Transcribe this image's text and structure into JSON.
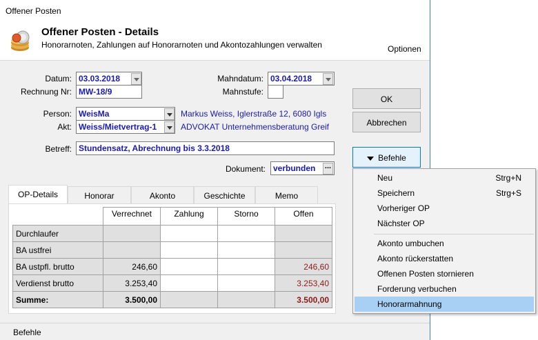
{
  "window": {
    "title": "Offener Posten"
  },
  "header": {
    "title": "Offener Posten - Details",
    "subtitle": "Honorarnoten, Zahlungen auf Honorarnoten und Akontozahlungen verwalten",
    "options_label": "Optionen",
    "icon": "coin-stack-icon"
  },
  "form": {
    "datum_label": "Datum:",
    "datum_value": "03.03.2018",
    "rechnung_label": "Rechnung Nr:",
    "rechnung_value": "MW-18/9",
    "mahndatum_label": "Mahndatum:",
    "mahndatum_value": "03.04.2018",
    "mahnstufe_label": "Mahnstufe:",
    "mahnstufe_value": "",
    "person_label": "Person:",
    "person_value": "WeisMa",
    "person_info": "Markus Weiss, Iglerstraße 12, 6080 Igls",
    "akt_label": "Akt:",
    "akt_value": "Weiss/Mietvertrag-1",
    "akt_info": "ADVOKAT Unternehmensberatung Greif",
    "betreff_label": "Betreff:",
    "betreff_value": "Stundensatz, Abrechnung bis 3.3.2018",
    "dokument_label": "Dokument:",
    "dokument_value": "verbunden"
  },
  "buttons": {
    "ok": "OK",
    "abbrechen": "Abbrechen",
    "befehle": "Befehle"
  },
  "tabs": [
    "OP-Details",
    "Honorar",
    "Akonto",
    "Geschichte",
    "Memo"
  ],
  "grid": {
    "columns": [
      "Verrechnet",
      "Zahlung",
      "Storno",
      "Offen"
    ],
    "rows": [
      {
        "label": "Durchlaufer",
        "verrechnet": "",
        "zahlung": "",
        "storno": "",
        "offen": ""
      },
      {
        "label": "BA ustfrei",
        "verrechnet": "",
        "zahlung": "",
        "storno": "",
        "offen": ""
      },
      {
        "label": "BA ustpfl. brutto",
        "verrechnet": "246,60",
        "zahlung": "",
        "storno": "",
        "offen": "246,60"
      },
      {
        "label": "Verdienst brutto",
        "verrechnet": "3.253,40",
        "zahlung": "",
        "storno": "",
        "offen": "3.253,40"
      },
      {
        "label": "Summe:",
        "verrechnet": "3.500,00",
        "zahlung": "",
        "storno": "",
        "offen": "3.500,00"
      }
    ]
  },
  "status": {
    "text": "Befehle"
  },
  "menu": {
    "items": [
      {
        "label": "Neu",
        "shortcut": "Strg+N"
      },
      {
        "label": "Speichern",
        "shortcut": "Strg+S"
      },
      {
        "label": "Vorheriger OP",
        "shortcut": ""
      },
      {
        "label": "Nächster OP",
        "shortcut": ""
      },
      {
        "label": "Akonto umbuchen",
        "shortcut": ""
      },
      {
        "label": "Akonto rückerstatten",
        "shortcut": ""
      },
      {
        "label": "Offenen Posten stornieren",
        "shortcut": ""
      },
      {
        "label": "Forderung verbuchen",
        "shortcut": ""
      },
      {
        "label": "Honorarmahnung",
        "shortcut": ""
      }
    ],
    "highlighted": "Honorarmahnung"
  },
  "colors": {
    "field_text": "#1a1ab0",
    "negative_red": "#8b1a1a",
    "highlight": "#a8d0f5"
  }
}
